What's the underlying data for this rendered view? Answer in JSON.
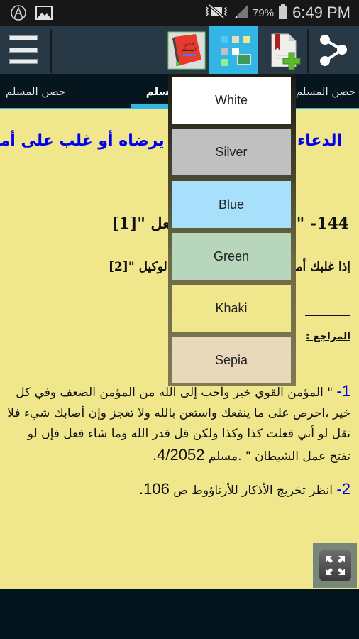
{
  "status_bar": {
    "left_icons": [
      "app-notification-icon",
      "image-icon"
    ],
    "right_icons": [
      "vibrate-mute-icon",
      "signal-icon",
      "battery-icon"
    ],
    "battery_percent": "79%",
    "time": "6:49 PM"
  },
  "toolbar": {
    "menu_icon": "hamburger-menu-icon",
    "icons": [
      {
        "name": "book-cover-icon",
        "active": false
      },
      {
        "name": "color-theme-icon",
        "active": true
      },
      {
        "name": "add-bookmark-icon",
        "active": false
      },
      {
        "name": "share-icon",
        "active": false
      }
    ]
  },
  "tabs": [
    {
      "label": "حصن المسلم",
      "selected": false
    },
    {
      "label": "حصن المسلم",
      "selected": true
    },
    {
      "label": "حصن المسلم",
      "selected": false
    }
  ],
  "content": {
    "title": "الدعاء لمن أصابه شيء يرضاه أو غلب على أمره",
    "line144": "144- \" قدر الله وما شاء فعل \"[1]",
    "line2": "إذا غلبك أمر فقل: حسبي الله ونعم الوكيل \"[2]",
    "dashes": "________",
    "references_label": "المراجع :",
    "ref1_num": "1-",
    "ref1_text": "\" المؤمن القوي خير وأحب إلى الله من المؤمن الضعف وفي كل خير ،احرص على ما ينفعك واستعن بالله ولا تعجز وإن أصابك شيء فلا تقل لو أني فعلت كذا وكذا ولكن قل قدر الله وما شاء فعل فإن لو تفتح عمل الشيطان \" .مسلم",
    "ref1_source": "4/2052.",
    "ref2_num": "2-",
    "ref2_text": "انظر تخريج الأذكار للأرناؤوط ص",
    "ref2_page": "106."
  },
  "fullscreen_button": {
    "icon": "expand-fullscreen-icon"
  },
  "color_menu": {
    "options": [
      {
        "label": "White",
        "color": "#ffffff"
      },
      {
        "label": "Silver",
        "color": "#c0c0c0"
      },
      {
        "label": "Blue",
        "color": "#a8e0fc"
      },
      {
        "label": "Green",
        "color": "#b8d6bc"
      },
      {
        "label": "Khaki",
        "color": "#f0e68c"
      },
      {
        "label": "Sepia",
        "color": "#e9d9bc"
      }
    ]
  },
  "colors": {
    "accent": "#33b5e5",
    "content_background": "#f0e68c",
    "title_color": "#0000ee"
  }
}
